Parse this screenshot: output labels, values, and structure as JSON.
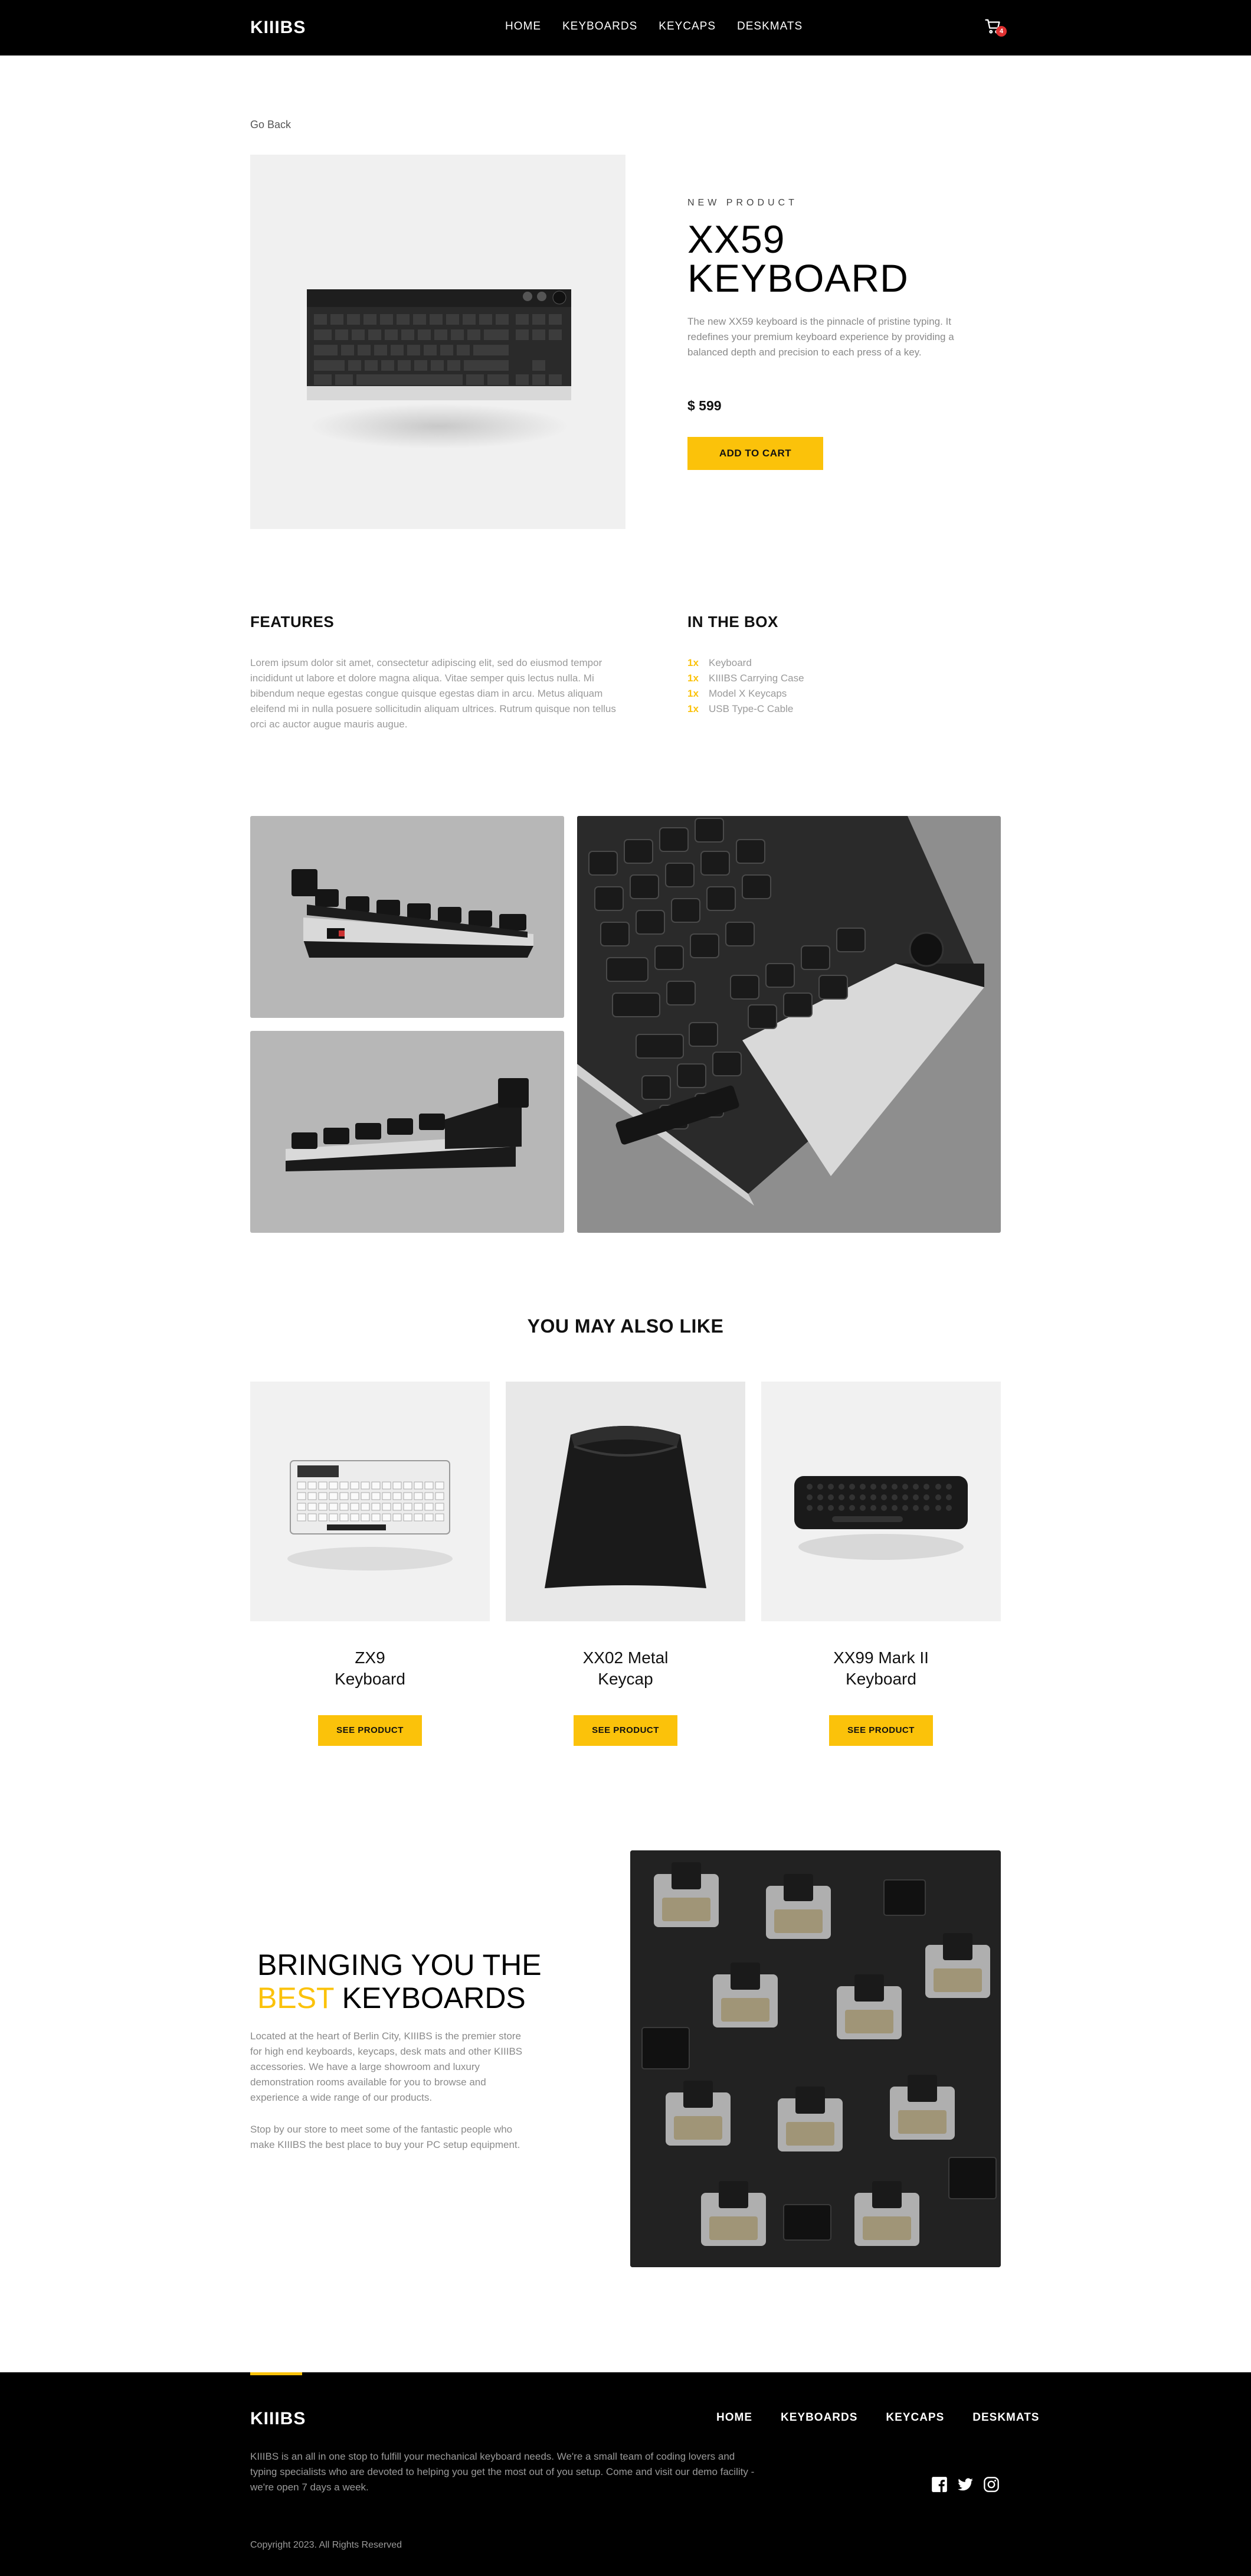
{
  "header": {
    "logo": "KIIIBS",
    "nav": [
      "HOME",
      "KEYBOARDS",
      "KEYCAPS",
      "DESKMATS"
    ],
    "cart_count": "4"
  },
  "goback": "Go Back",
  "product": {
    "eyebrow": "NEW PRODUCT",
    "title_line1": "XX59",
    "title_line2": "KEYBOARD",
    "description": "The new XX59 keyboard is the pinnacle of pristine typing. It redefines your premium keyboard experience by providing a balanced depth and precision to each press of a key.",
    "price": "$ 599",
    "add_to_cart": "ADD TO CART"
  },
  "features": {
    "title": "FEATURES",
    "text": "Lorem ipsum dolor sit amet, consectetur adipiscing elit, sed do eiusmod tempor incididunt ut labore et dolore magna aliqua. Vitae semper quis lectus nulla. Mi bibendum neque egestas congue quisque egestas diam in arcu. Metus aliquam eleifend mi in nulla posuere sollicitudin aliquam ultrices. Rutrum quisque non tellus orci ac auctor augue mauris augue."
  },
  "in_the_box": {
    "title": "IN THE BOX",
    "items": [
      {
        "qty": "1x",
        "name": "Keyboard"
      },
      {
        "qty": "1x",
        "name": "KIIIBS Carrying Case"
      },
      {
        "qty": "1x",
        "name": "Model X Keycaps"
      },
      {
        "qty": "1x",
        "name": "USB Type-C Cable"
      }
    ]
  },
  "also_like": {
    "title": "YOU MAY ALSO LIKE",
    "products": [
      {
        "line1": "ZX9",
        "line2": "Keyboard",
        "button": "SEE PRODUCT"
      },
      {
        "line1": "XX02 Metal",
        "line2": "Keycap",
        "button": "SEE PRODUCT"
      },
      {
        "line1": "XX99 Mark II",
        "line2": "Keyboard",
        "button": "SEE PRODUCT"
      }
    ]
  },
  "about": {
    "title_line1": "BRINGING YOU THE",
    "title_highlight": "BEST",
    "title_rest": " KEYBOARDS",
    "p1": "Located at the heart of Berlin City, KIIIBS is the premier store for high end keyboards, keycaps, desk mats and other KIIIBS accessories. We have a large showroom and luxury demonstration rooms available for you to browse and experience a wide range of our products.",
    "p2": "Stop by our store to meet some of the fantastic people who make KIIIBS the best place to buy your PC setup equipment."
  },
  "footer": {
    "logo": "KIIIBS",
    "nav": [
      "HOME",
      "KEYBOARDS",
      "KEYCAPS",
      "DESKMATS"
    ],
    "description": "KIIIBS is an all in one stop to fulfill your mechanical keyboard needs. We're a small team of coding lovers and typing specialists who are devoted to helping you get the most out of you setup. Come and visit our demo facility - we're open 7 days a week.",
    "copyright": "Copyright 2023. All Rights Reserved",
    "social_icons": [
      "facebook-icon",
      "twitter-icon",
      "instagram-icon"
    ]
  },
  "colors": {
    "accent": "#fbc20a",
    "header_bg": "#000000",
    "card_bg": "#f1f1f1",
    "badge": "#e03131"
  }
}
